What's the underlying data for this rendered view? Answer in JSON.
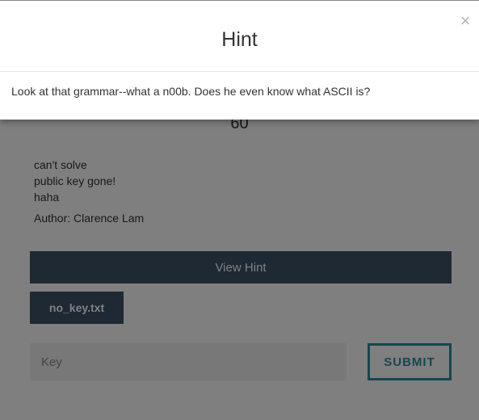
{
  "modal": {
    "title": "Hint",
    "close_icon": "close-icon",
    "close_glyph": "×",
    "body": "Look at that grammar--what a n00b. Does he even know what ASCII is?"
  },
  "challenge": {
    "points": "60",
    "description_lines": [
      "can't solve",
      "public key gone!",
      "haha"
    ],
    "author": "Author: Clarence Lam",
    "view_hint_label": "View Hint",
    "file_label": "no_key.txt",
    "key_placeholder": "Key",
    "submit_label": "SUBMIT"
  },
  "colors": {
    "button_bg": "#3f5269",
    "submit_accent": "#2b8e9a",
    "backdrop": "rgba(0,0,0,0.5)"
  }
}
